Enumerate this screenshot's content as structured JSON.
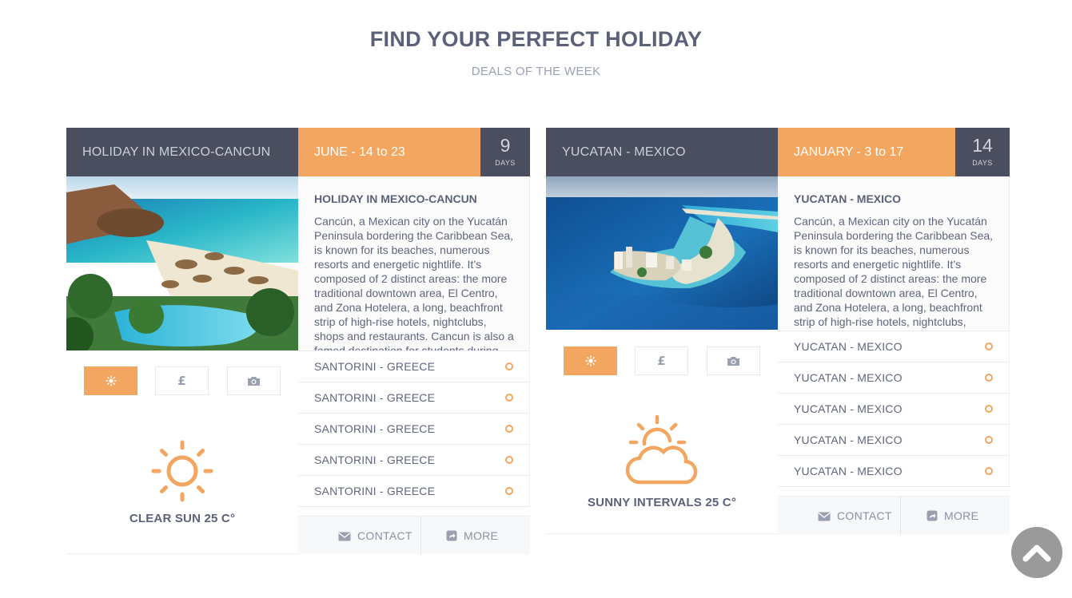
{
  "header": {
    "title": "FIND YOUR PERFECT HOLIDAY",
    "subtitle": "DEALS OF THE WEEK"
  },
  "cards": [
    {
      "name": "HOLIDAY IN MEXICO-CANCUN",
      "dates": "JUNE - 14 to 23",
      "days": "9",
      "days_label": "DAYS",
      "desc_title": "HOLIDAY IN MEXICO-CANCUN",
      "desc_text": "Cancún, a Mexican city on the Yucatán Peninsula bordering the Caribbean Sea, is known for its beaches, numerous resorts and energetic nightlife. It’s composed of 2 distinct areas: the more traditional downtown area, El Centro, and Zona Hotelera, a long, beachfront strip of high-rise hotels, nightclubs, shops and restaurants. Cancun is also a famed destination for students during",
      "tabs": [
        "weather-icon",
        "pound-icon",
        "camera-icon"
      ],
      "weather": "CLEAR SUN 25 C°",
      "weather_icon": "sun-icon",
      "list": [
        "SANTORINI - GREECE",
        "SANTORINI - GREECE",
        "SANTORINI - GREECE",
        "SANTORINI - GREECE",
        "SANTORINI - GREECE"
      ],
      "contact": "CONTACT",
      "more": "MORE"
    },
    {
      "name": "YUCATAN - MEXICO",
      "dates": "JANUARY - 3 to 17",
      "days": "14",
      "days_label": "DAYS",
      "desc_title": "YUCATAN - MEXICO",
      "desc_text": "Cancún, a Mexican city on the Yucatán Peninsula bordering the Caribbean Sea, is known for its beaches, numerous resorts and energetic nightlife. It’s composed of 2 distinct areas: the more traditional downtown area, El Centro, and Zona Hotelera, a long, beachfront strip of high-rise hotels, nightclubs,",
      "tabs": [
        "weather-icon",
        "pound-icon",
        "camera-icon"
      ],
      "weather": "SUNNY INTERVALS 25 C°",
      "weather_icon": "sun-cloud-icon",
      "list": [
        "YUCATAN - MEXICO",
        "YUCATAN - MEXICO",
        "YUCATAN - MEXICO",
        "YUCATAN - MEXICO",
        "YUCATAN - MEXICO"
      ],
      "contact": "CONTACT",
      "more": "MORE"
    }
  ],
  "colors": {
    "accent": "#f2a65f",
    "dark": "#4a4e5e",
    "text": "#5b6178"
  },
  "scroll_top_icon": "chevron-up-icon"
}
